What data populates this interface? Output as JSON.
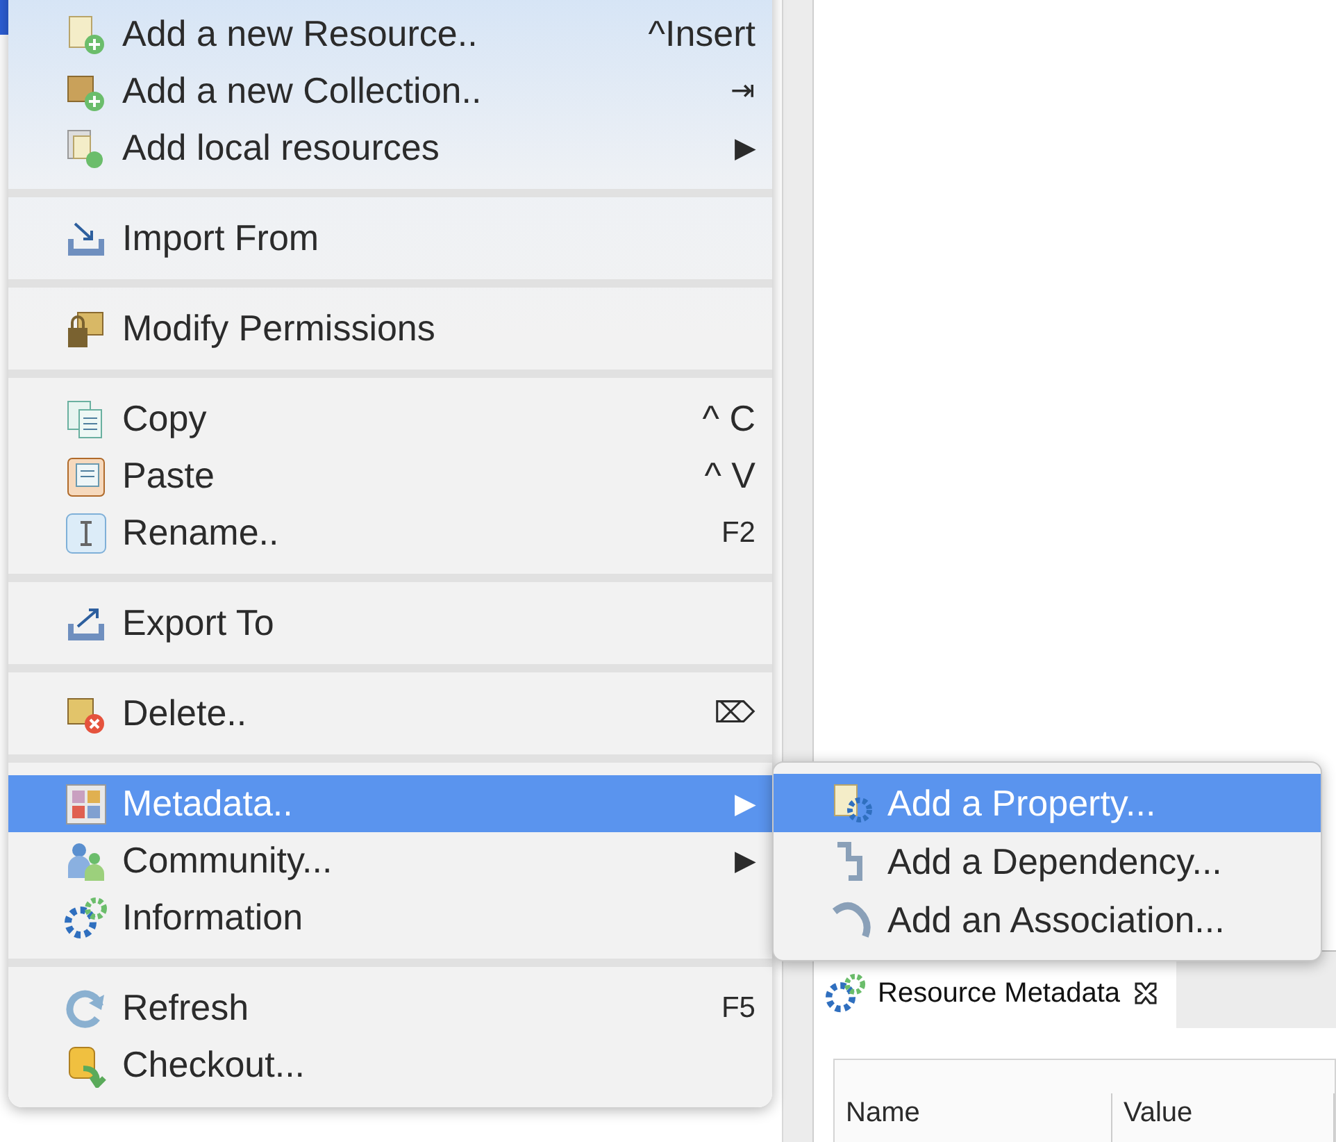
{
  "context_menu": {
    "groups": [
      [
        {
          "label": "Add a new Resource..",
          "shortcut": "^Insert",
          "selected": false
        },
        {
          "label": "Add a new Collection..",
          "shortcut": "⇥",
          "selected": false
        },
        {
          "label": "Add local resources",
          "arrow": "▶",
          "selected": false
        }
      ],
      [
        {
          "label": "Import From",
          "selected": false
        }
      ],
      [
        {
          "label": "Modify Permissions",
          "selected": false
        }
      ],
      [
        {
          "label": "Copy",
          "shortcut": "^ C",
          "selected": false
        },
        {
          "label": "Paste",
          "shortcut": "^ V",
          "selected": false
        },
        {
          "label": "Rename..",
          "shortcut": "F2",
          "selected": false
        }
      ],
      [
        {
          "label": "Export To",
          "selected": false
        }
      ],
      [
        {
          "label": "Delete..",
          "shortcut": "⌦",
          "selected": false
        }
      ],
      [
        {
          "label": "Metadata..",
          "arrow": "▶",
          "selected": true
        },
        {
          "label": "Community...",
          "arrow": "▶",
          "selected": false
        },
        {
          "label": "Information",
          "selected": false
        }
      ],
      [
        {
          "label": "Refresh",
          "shortcut": "F5",
          "selected": false
        },
        {
          "label": "Checkout...",
          "selected": false
        }
      ]
    ]
  },
  "submenu": {
    "items": [
      {
        "label": "Add a Property...",
        "selected": true
      },
      {
        "label": "Add a Dependency...",
        "selected": false
      },
      {
        "label": "Add an Association...",
        "selected": false
      }
    ]
  },
  "view_tab": {
    "label": "Resource Metadata",
    "selected": true
  },
  "table": {
    "columns": [
      "Name",
      "Value"
    ]
  }
}
